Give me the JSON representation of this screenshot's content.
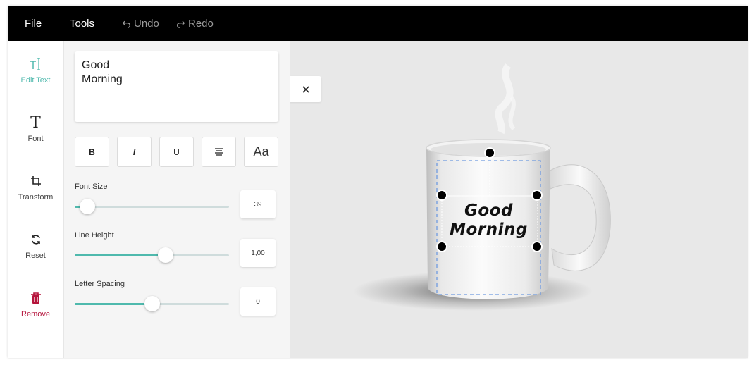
{
  "menu": {
    "file": "File",
    "tools": "Tools",
    "undo": "Undo",
    "redo": "Redo"
  },
  "sidebar": {
    "items": [
      {
        "label": "Edit Text",
        "icon": "edit-text-icon"
      },
      {
        "label": "Font",
        "icon": "font-icon"
      },
      {
        "label": "Transform",
        "icon": "crop-icon"
      },
      {
        "label": "Reset",
        "icon": "reset-icon"
      },
      {
        "label": "Remove",
        "icon": "trash-icon"
      }
    ]
  },
  "editor": {
    "text_line1": "Good",
    "text_line2": "Morning",
    "format_buttons": [
      "B",
      "I",
      "U",
      "align-center",
      "Aa"
    ],
    "font_size": {
      "label": "Font Size",
      "value": "39",
      "fraction": 0.08
    },
    "line_height": {
      "label": "Line Height",
      "value": "1,00",
      "fraction": 0.59
    },
    "letter_spacing": {
      "label": "Letter Spacing",
      "value": "0",
      "fraction": 0.5
    }
  },
  "canvas": {
    "print_line1": "Good",
    "print_line2": "Morning"
  },
  "colors": {
    "accent": "#4fb9ad",
    "danger": "#b5143c",
    "topbar": "#000000"
  }
}
